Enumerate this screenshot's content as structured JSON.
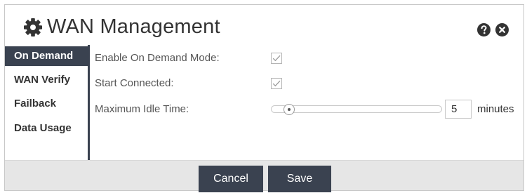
{
  "title": "WAN Management",
  "icons": {
    "title_icon": "gear-icon",
    "help_icon": "question-circle-icon",
    "close_icon": "close-circle-icon"
  },
  "colors": {
    "accent_dark": "#3a4250",
    "footer_bg": "#e6e6e6",
    "check_gray": "#9a9a9a"
  },
  "sidebar": {
    "items": [
      {
        "label": "On Demand",
        "active": true
      },
      {
        "label": "WAN Verify",
        "active": false
      },
      {
        "label": "Failback",
        "active": false
      },
      {
        "label": "Data Usage",
        "active": false
      }
    ]
  },
  "form": {
    "enable_on_demand": {
      "label": "Enable On Demand Mode:",
      "checked": true
    },
    "start_connected": {
      "label": "Start Connected:",
      "checked": true
    },
    "max_idle": {
      "label": "Maximum Idle Time:",
      "value": "5",
      "unit": "minutes",
      "slider_position": 0.08
    }
  },
  "footer": {
    "cancel_label": "Cancel",
    "save_label": "Save"
  }
}
